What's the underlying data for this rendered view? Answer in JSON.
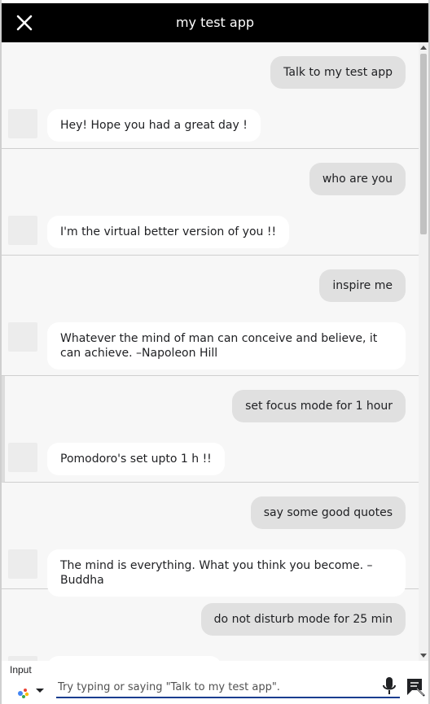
{
  "header": {
    "title": "my test app",
    "close_icon": "close-icon"
  },
  "conversation": [
    {
      "user": "Talk to my test app",
      "bot": "Hey! Hope you had a great day !"
    },
    {
      "user": "who are you",
      "bot": "I'm the virtual better version of you !!"
    },
    {
      "user": "inspire me",
      "bot": "Whatever the mind of man can conceive and believe, it can achieve. –Napoleon Hill"
    },
    {
      "user": "set focus mode for 1 hour",
      "bot": "Pomodoro's set upto 1 h !!"
    },
    {
      "user": "say some good quotes",
      "bot": "The mind is everything. What you think you become. –Buddha"
    },
    {
      "user": "do not disturb mode for 25 min",
      "bot": ""
    }
  ],
  "footer": {
    "input_label": "Input",
    "input_placeholder": "Try typing or saying \"Talk to my test app\".",
    "input_value": "",
    "assistant_icon": "google-assistant-icon",
    "mic_icon": "microphone-icon",
    "send_icon": "send-message-icon"
  },
  "colors": {
    "header_bg": "#000000",
    "user_bubble": "#e0e0e0",
    "bot_bubble": "#ffffff",
    "chat_bg": "#f7f7f7",
    "input_underline": "#1a3d8f"
  }
}
